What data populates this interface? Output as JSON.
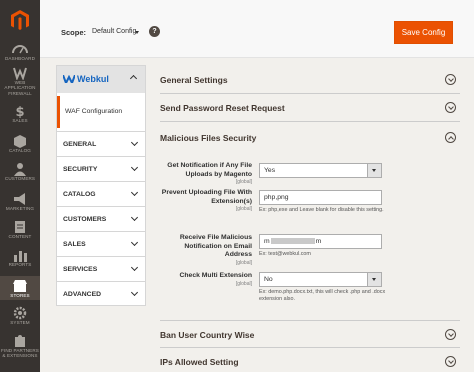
{
  "admin_menu": {
    "items": [
      {
        "icon": "dashboard-icon",
        "label": "Dashboard"
      },
      {
        "icon": "waf-icon",
        "label": "Web Application Firewall"
      },
      {
        "icon": "dollar-icon",
        "label": "Sales"
      },
      {
        "icon": "cube-icon",
        "label": "Catalog"
      },
      {
        "icon": "person-icon",
        "label": "Customers"
      },
      {
        "icon": "megaphone-icon",
        "label": "Marketing"
      },
      {
        "icon": "content-icon",
        "label": "Content"
      },
      {
        "icon": "bar-chart-icon",
        "label": "Reports"
      },
      {
        "icon": "store-icon",
        "label": "Stores"
      },
      {
        "icon": "gear-icon",
        "label": "System"
      },
      {
        "icon": "puzzle-icon",
        "label": "Find Partners & Extensions"
      }
    ],
    "active": "Stores",
    "accent": "#eb5202"
  },
  "header": {
    "scope_label": "Scope:",
    "scope_value": "Default Config",
    "help_icon": "question-icon",
    "save_label": "Save Config"
  },
  "tabs": {
    "brand": "Webkul",
    "active_item": "WAF Configuration",
    "groups": [
      "General",
      "Security",
      "Catalog",
      "Customers",
      "Sales",
      "Services",
      "Advanced"
    ]
  },
  "sections": {
    "general": "General Settings",
    "password_reset": "Send Password Reset Request",
    "malicious": "Malicious Files Security",
    "ban_country": "Ban User Country Wise",
    "ips_allowed": "IPs Allowed Setting"
  },
  "fields": {
    "notification": {
      "label": "Get Notification if Any File Uploads by Magento",
      "scope": "[global]",
      "value": "Yes"
    },
    "prevent": {
      "label": "Prevent Uploading File With Extension(s)",
      "scope": "[global]",
      "value": "php,png",
      "note": "Ex: php,exe and Leave blank for disable this setting."
    },
    "receive": {
      "label": "Receive File Malicious Notification on Email Address",
      "scope": "[global]",
      "value_prefix": "m",
      "value_suffix": "m",
      "note": "Ex: test@webkul.com"
    },
    "multi_ext": {
      "label": "Check Multi Extension",
      "scope": "[global]",
      "value": "No",
      "note": "Ex: demo.php.docx.txt, this will check .php and .docx extension also."
    }
  }
}
